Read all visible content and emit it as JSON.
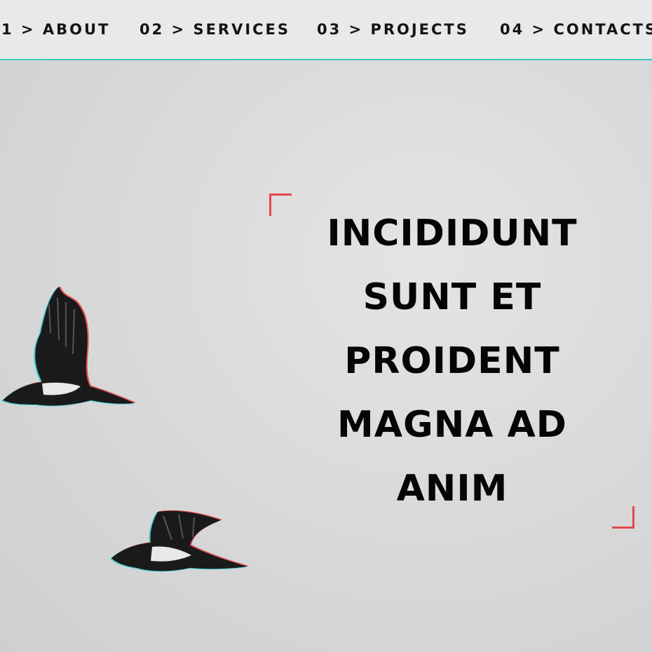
{
  "nav": {
    "items": [
      {
        "label": "1 > ABOUT"
      },
      {
        "label": "02 > SERVICES"
      },
      {
        "label": "03 > PROJECTS"
      },
      {
        "label": "04 > CONTACTS"
      }
    ]
  },
  "hero": {
    "headline_lines": [
      "INCIDIDUNT",
      "SUNT ET",
      "PROIDENT",
      "MAGNA AD",
      "ANIM"
    ]
  },
  "colors": {
    "background": "#dcdcdc",
    "nav_background": "#e9e9e9",
    "nav_border": "#3ec8c2",
    "bracket": "#e5474b",
    "text": "#050505",
    "glitch_red": "#e53a3a",
    "glitch_cyan": "#2ad0d0"
  },
  "icons": {
    "bird_1": "flying-bird-icon",
    "bird_2": "flying-bird-icon",
    "bracket_top_left": "corner-bracket-icon",
    "bracket_bottom_right": "corner-bracket-icon"
  }
}
